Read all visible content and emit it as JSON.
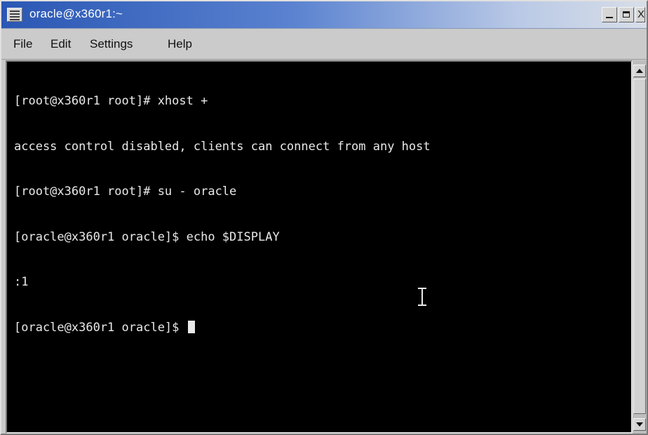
{
  "window": {
    "title": "oracle@x360r1:~"
  },
  "title_buttons": {
    "close_glyph": "X"
  },
  "menubar": {
    "items": [
      "File",
      "Edit",
      "Settings",
      "Help"
    ]
  },
  "terminal": {
    "lines": [
      "[root@x360r1 root]# xhost +",
      "access control disabled, clients can connect from any host",
      "[root@x360r1 root]# su - oracle",
      "[oracle@x360r1 oracle]$ echo $DISPLAY",
      ":1",
      "[oracle@x360r1 oracle]$ "
    ],
    "background": "#000000",
    "foreground": "#e9e9e9"
  },
  "icons": {
    "window_menu": "window-menu-icon",
    "minimize": "minimize-icon",
    "maximize": "maximize-icon",
    "close": "close-icon",
    "scroll_up": "arrow-up-icon",
    "scroll_down": "arrow-down-icon",
    "text_cursor": "i-beam-cursor-icon"
  },
  "colors": {
    "titlebar_start": "#2a57b4",
    "titlebar_end": "#d8dee8",
    "chrome": "#c9c9c9"
  }
}
